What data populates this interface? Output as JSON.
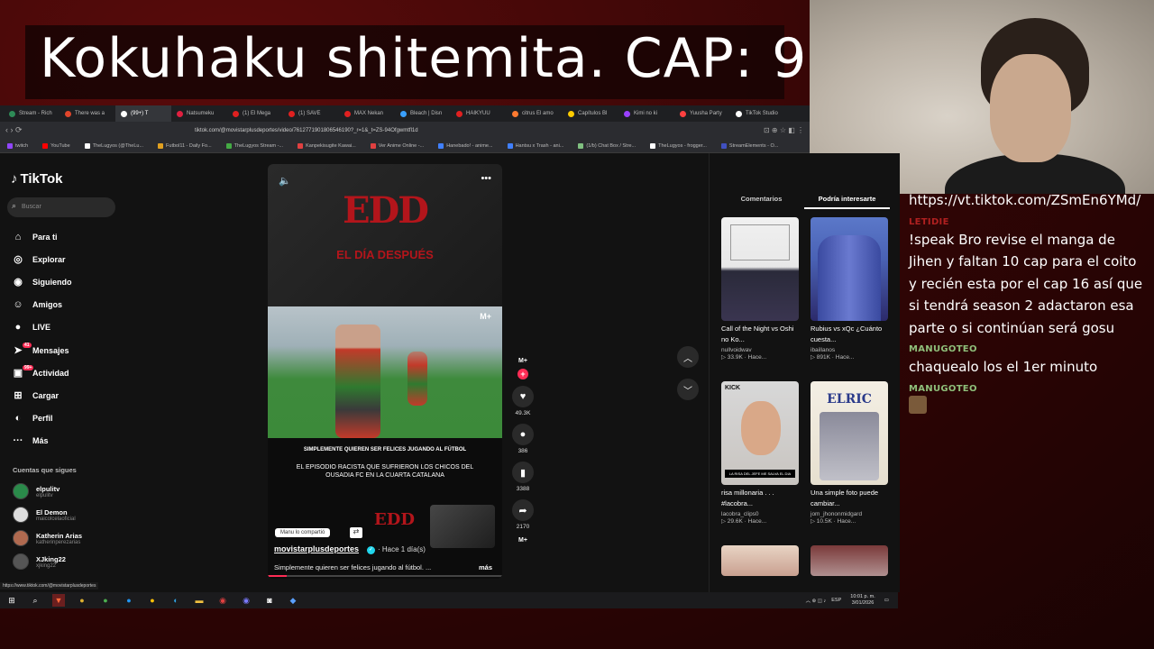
{
  "overlay": {
    "title": "Kokuhaku shitemita. CAP: 9"
  },
  "chat": {
    "messages": [
      {
        "user": "",
        "text": "https://vt.tiktok.com/ZSmEn6YMd/"
      },
      {
        "user": "LETIDIE",
        "text": "!speak Bro revise el manga de Jihen y faltan 10 cap para el coito y recién esta por el cap 16 así que si tendrá season 2 adactaron esa parte o si continúan será gosu"
      },
      {
        "user": "MANUGOTEO",
        "text": "chaquealo los el 1er minuto"
      },
      {
        "user": "MANUGOTEO",
        "text": ""
      }
    ]
  },
  "browser": {
    "tabs": [
      {
        "label": "Stream - Rich",
        "color": "#2e8b57"
      },
      {
        "label": "There was a",
        "color": "#e0452b"
      },
      {
        "label": "(99+) T",
        "color": "#ffffff"
      },
      {
        "label": "Natsumeku",
        "color": "#e02040"
      },
      {
        "label": "(1) El Mega",
        "color": "#e02020"
      },
      {
        "label": "(1) SAVE",
        "color": "#e02020"
      },
      {
        "label": "MAX Nekan",
        "color": "#e02020"
      },
      {
        "label": "Bleach | Disn",
        "color": "#3aa0ff"
      },
      {
        "label": "HAIKYUU",
        "color": "#e02020"
      },
      {
        "label": "citrus El amo",
        "color": "#ff7a30"
      },
      {
        "label": "Capítulos Bl",
        "color": "#ffcc00"
      },
      {
        "label": "Kimi no ki",
        "color": "#9a40ff"
      },
      {
        "label": "Yuusha Party",
        "color": "#ff4040"
      },
      {
        "label": "TikTok Studio",
        "color": "#ffffff"
      }
    ],
    "url": "tiktok.com/@movistarplusdeportes/video/7612771901806546190?_r=1&_t=ZS-94Ofgwmtfl1d",
    "bookmarks": [
      {
        "label": "twitch",
        "color": "#9146ff"
      },
      {
        "label": "YouTube",
        "color": "#ff0000"
      },
      {
        "label": "TheLugyos (@TheLu...",
        "color": "#ffffff"
      },
      {
        "label": "Futbol11 - Daily Fo...",
        "color": "#e0a020"
      },
      {
        "label": "TheLugyos Stream -...",
        "color": "#44aa44"
      },
      {
        "label": "Kanpekisugite Kawai...",
        "color": "#e04040"
      },
      {
        "label": "Ver Anime Online -...",
        "color": "#e04040"
      },
      {
        "label": "Hanebado! - anime...",
        "color": "#4080ff"
      },
      {
        "label": "Hantsu x Trash - ani...",
        "color": "#4080ff"
      },
      {
        "label": "(1/b) Chat Box / Stre...",
        "color": "#80c080"
      },
      {
        "label": "TheLugyos - frogger...",
        "color": "#ffffff"
      },
      {
        "label": "StreamElements - O...",
        "color": "#4050c0"
      }
    ]
  },
  "tiktok": {
    "logo": "TikTok",
    "search_placeholder": "Buscar",
    "nav": [
      {
        "label": "Para ti",
        "icon": "home-icon",
        "glyph": "⌂"
      },
      {
        "label": "Explorar",
        "icon": "compass-icon",
        "glyph": "◎"
      },
      {
        "label": "Siguiendo",
        "icon": "following-icon",
        "glyph": "◉"
      },
      {
        "label": "Amigos",
        "icon": "friends-icon",
        "glyph": "☺"
      },
      {
        "label": "LIVE",
        "icon": "live-icon",
        "glyph": "●"
      },
      {
        "label": "Mensajes",
        "icon": "messages-icon",
        "glyph": "➤",
        "badge": "41"
      },
      {
        "label": "Actividad",
        "icon": "activity-icon",
        "glyph": "▣",
        "badge": "99+"
      },
      {
        "label": "Cargar",
        "icon": "upload-icon",
        "glyph": "⊞"
      },
      {
        "label": "Perfil",
        "icon": "profile-icon",
        "glyph": "◐"
      },
      {
        "label": "Más",
        "icon": "more-icon",
        "glyph": "···"
      }
    ],
    "following_title": "Cuentas que sigues",
    "following": [
      {
        "name": "elpulitv",
        "handle": "elpulitv",
        "color": "#2a8a4a"
      },
      {
        "name": "El Demon",
        "handle": "maicolcelaoficial",
        "color": "#dddddd"
      },
      {
        "name": "Katherin Arias",
        "handle": "katherinperezarias",
        "color": "#b06a50"
      },
      {
        "name": "XJking22",
        "handle": "xjking22",
        "color": "#555555"
      }
    ],
    "video": {
      "brand_big": "EDD",
      "brand_sub": "EL DÍA DESPUÉS",
      "caption_headline": "SIMPLEMENTE QUIEREN SER FELICES JUGANDO AL FÚTBOL",
      "caption_body": "EL EPISODIO RACISTA QUE SUFRIERON LOS CHICOS DEL OUSADIA FC EN LA CUARTA CATALANA",
      "shared_label": "Manu lo compartió",
      "author": "movistarplusdeportes",
      "time": "· Hace 1 día(s)",
      "description": "Simplemente quieren ser felices jugando al fútbol. ...",
      "more": "más"
    },
    "actions": {
      "likes": "49.3K",
      "comments": "386",
      "saves": "3388",
      "shares": "2170"
    },
    "right_tabs": [
      "Comentarios",
      "Podría interesarte"
    ],
    "cards": [
      {
        "title": "Call of the Night vs Oshi no Ko...",
        "author": "nullvoidwav",
        "stats": "▷ 33.9K · Hace..."
      },
      {
        "title": "Rubius vs xQc ¿Cuánto cuesta...",
        "author": "ibaillanos",
        "stats": "▷ 891K · Hace..."
      },
      {
        "title": "risa millonaria . . . #lacobra...",
        "author": "lacobra_clips0",
        "stats": "▷ 29.6K · Hace..."
      },
      {
        "title": "Una simple foto puede cambiar...",
        "author": "jom_jhononmidgard",
        "stats": "▷ 10.5K · Hace..."
      }
    ],
    "card_overlays": {
      "kick_label": "KICK",
      "kick_caption": "LA RISA DEL JEFE ME SALVA EL DIA",
      "elric_label": "ELRIC"
    }
  },
  "statusbar": {
    "url": "https://www.tiktok.com/@movistarplusdeportes"
  },
  "taskbar": {
    "lang": "ESP",
    "time": "10:01 p. m.",
    "date": "3/01/2026"
  }
}
